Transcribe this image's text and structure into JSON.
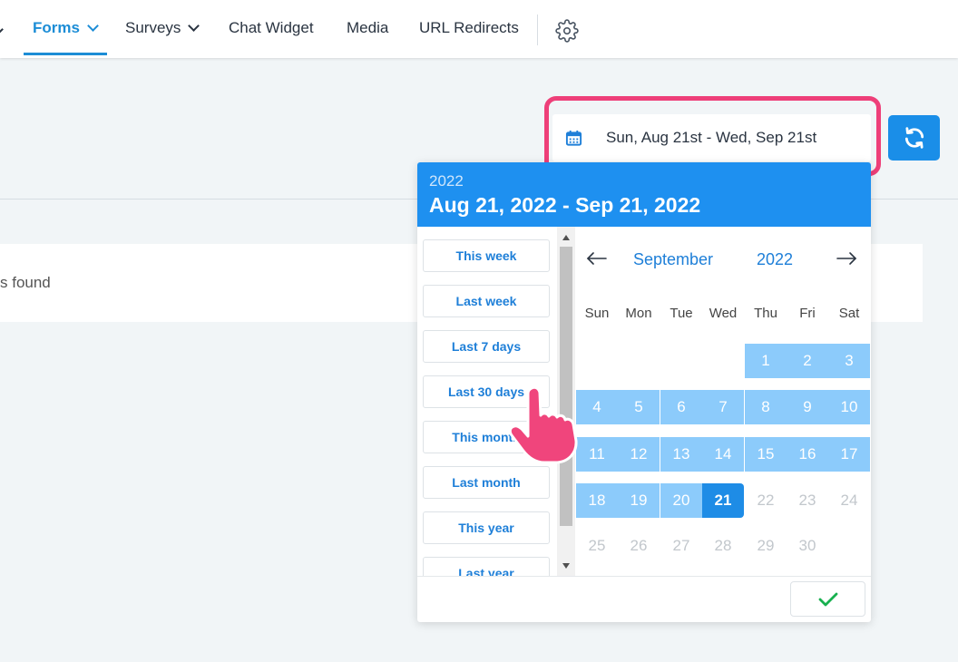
{
  "nav": {
    "items": [
      {
        "label": "Forms",
        "dropdown": true,
        "active": true
      },
      {
        "label": "Surveys",
        "dropdown": true,
        "active": false
      },
      {
        "label": "Chat Widget",
        "dropdown": false,
        "active": false
      },
      {
        "label": "Media",
        "dropdown": false,
        "active": false
      },
      {
        "label": "URL Redirects",
        "dropdown": false,
        "active": false
      }
    ],
    "settings_icon": "gear-icon"
  },
  "content": {
    "results_text": "s found"
  },
  "date_filter": {
    "value": "Sun, Aug 21st - Wed, Sep 21st",
    "icon": "calendar-icon",
    "refresh_icon": "refresh-icon"
  },
  "picker": {
    "header_year": "2022",
    "header_range": "Aug 21, 2022 - Sep 21, 2022",
    "presets": [
      "This week",
      "Last week",
      "Last 7 days",
      "Last 30 days",
      "This month",
      "Last month",
      "This year",
      "Last year"
    ],
    "month": "September",
    "year": "2022",
    "prev_icon": "arrow-left-icon",
    "next_icon": "arrow-right-icon",
    "weekdays": [
      "Sun",
      "Mon",
      "Tue",
      "Wed",
      "Thu",
      "Fri",
      "Sat"
    ],
    "weeks": [
      [
        "",
        "",
        "",
        "",
        "1",
        "2",
        "3"
      ],
      [
        "4",
        "5",
        "6",
        "7",
        "8",
        "9",
        "10"
      ],
      [
        "11",
        "12",
        "13",
        "14",
        "15",
        "16",
        "17"
      ],
      [
        "18",
        "19",
        "20",
        "21",
        "22",
        "23",
        "24"
      ],
      [
        "25",
        "26",
        "27",
        "28",
        "29",
        "30",
        ""
      ]
    ],
    "selected_day": "21",
    "apply_icon": "check-icon"
  },
  "colors": {
    "accent": "#1e90f0",
    "range_fill": "#8ccbfb",
    "highlight": "#ee3f79",
    "check": "#18b04f"
  }
}
